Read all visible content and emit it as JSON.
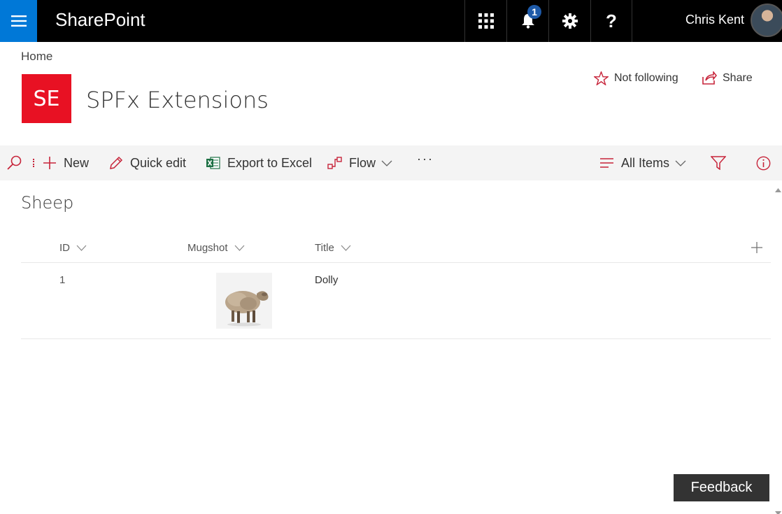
{
  "suitebar": {
    "brand": "SharePoint",
    "notification_count": "1",
    "user_name": "Chris Kent",
    "accent_color": "#0078d7"
  },
  "header": {
    "breadcrumb": "Home",
    "site_logo_initials": "SE",
    "site_logo_color": "#e81123",
    "site_title": "SPFx Extensions",
    "follow_label": "Not following",
    "share_label": "Share"
  },
  "commandbar": {
    "new_label": "New",
    "quick_edit_label": "Quick edit",
    "export_label": "Export to Excel",
    "flow_label": "Flow",
    "more_label": "···",
    "view_label": "All Items"
  },
  "list": {
    "title": "Sheep",
    "columns": [
      "ID",
      "Mugshot",
      "Title"
    ],
    "rows": [
      {
        "id": "1",
        "title": "Dolly"
      }
    ]
  },
  "feedback_label": "Feedback"
}
